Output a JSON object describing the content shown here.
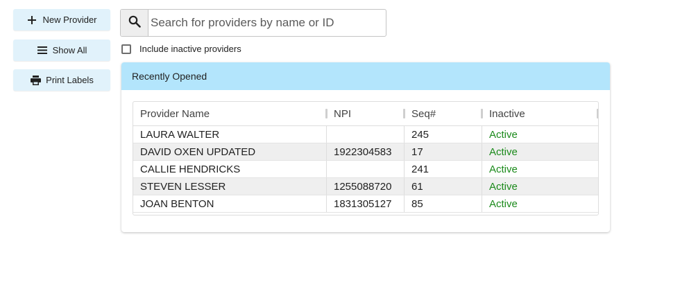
{
  "sidebar": {
    "new_provider_label": "New Provider",
    "show_all_label": "Show All",
    "print_labels_label": "Print Labels"
  },
  "search": {
    "placeholder": "Search for providers by name or ID",
    "value": ""
  },
  "filter": {
    "include_inactive_label": "Include inactive providers",
    "include_inactive_checked": false
  },
  "recent": {
    "title": "Recently Opened",
    "columns": [
      "Provider Name",
      "NPI",
      "Seq#",
      "Inactive"
    ],
    "rows": [
      {
        "name": "LAURA WALTER",
        "npi": "",
        "seq": "245",
        "status": "Active"
      },
      {
        "name": "DAVID OXEN UPDATED",
        "npi": "1922304583",
        "seq": "17",
        "status": "Active"
      },
      {
        "name": "CALLIE HENDRICKS",
        "npi": "",
        "seq": "241",
        "status": "Active"
      },
      {
        "name": "STEVEN LESSER",
        "npi": "1255088720",
        "seq": "61",
        "status": "Active"
      },
      {
        "name": "JOAN BENTON",
        "npi": "1831305127",
        "seq": "85",
        "status": "Active"
      }
    ]
  },
  "colors": {
    "button_bg": "#e1f2fb",
    "panel_header_bg": "#b3e5fc",
    "active_status": "#1b8a1b"
  },
  "icons": {
    "new_provider": "plus-icon",
    "show_all": "menu-icon",
    "print_labels": "printer-icon",
    "search": "search-icon"
  }
}
